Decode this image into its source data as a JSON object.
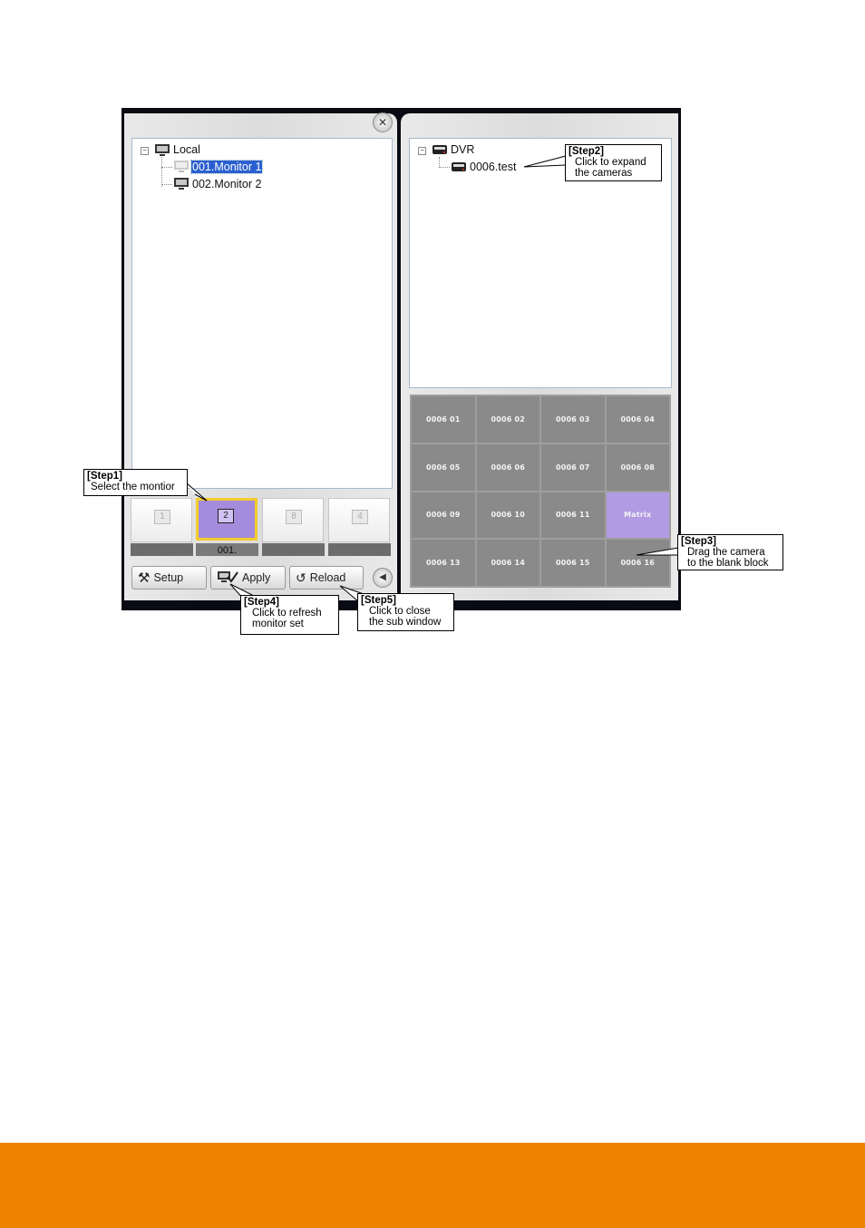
{
  "left_tree": {
    "root_label": "Local",
    "children": [
      "001.Monitor 1",
      "002.Monitor 2"
    ]
  },
  "right_tree": {
    "root_label": "DVR",
    "children": [
      "0006.test"
    ]
  },
  "monitor_layouts": [
    "1",
    "2",
    "8",
    "4"
  ],
  "monitor_labels": [
    "",
    "001.",
    "",
    ""
  ],
  "toolbar": {
    "setup": "Setup",
    "apply": "Apply",
    "reload": "Reload"
  },
  "camera_grid": [
    "0006 01",
    "0006 02",
    "0006 03",
    "0006 04",
    "0006 05",
    "0006 06",
    "0006 07",
    "0006 08",
    "0006 09",
    "0006 10",
    "0006 11",
    "Matrix",
    "0006 13",
    "0006 14",
    "0006 15",
    "0006 16"
  ],
  "callouts": {
    "step1": {
      "title": "[Step1]",
      "text": "Select the montior"
    },
    "step2": {
      "title": "[Step2]",
      "line1": "Click to expand",
      "line2": "the cameras"
    },
    "step3": {
      "title": "[Step3]",
      "line1": "Drag the camera",
      "line2": "to the blank block"
    },
    "step4": {
      "title": "[Step4]",
      "line1": "Click to refresh",
      "line2": "monitor set"
    },
    "step5": {
      "title": "[Step5]",
      "line1": "Click to close",
      "line2": "the sub window"
    }
  },
  "colors": {
    "footer": "#ee8300",
    "matrix_cell": "#b39be4",
    "selected_node": "#2a5fcf"
  }
}
